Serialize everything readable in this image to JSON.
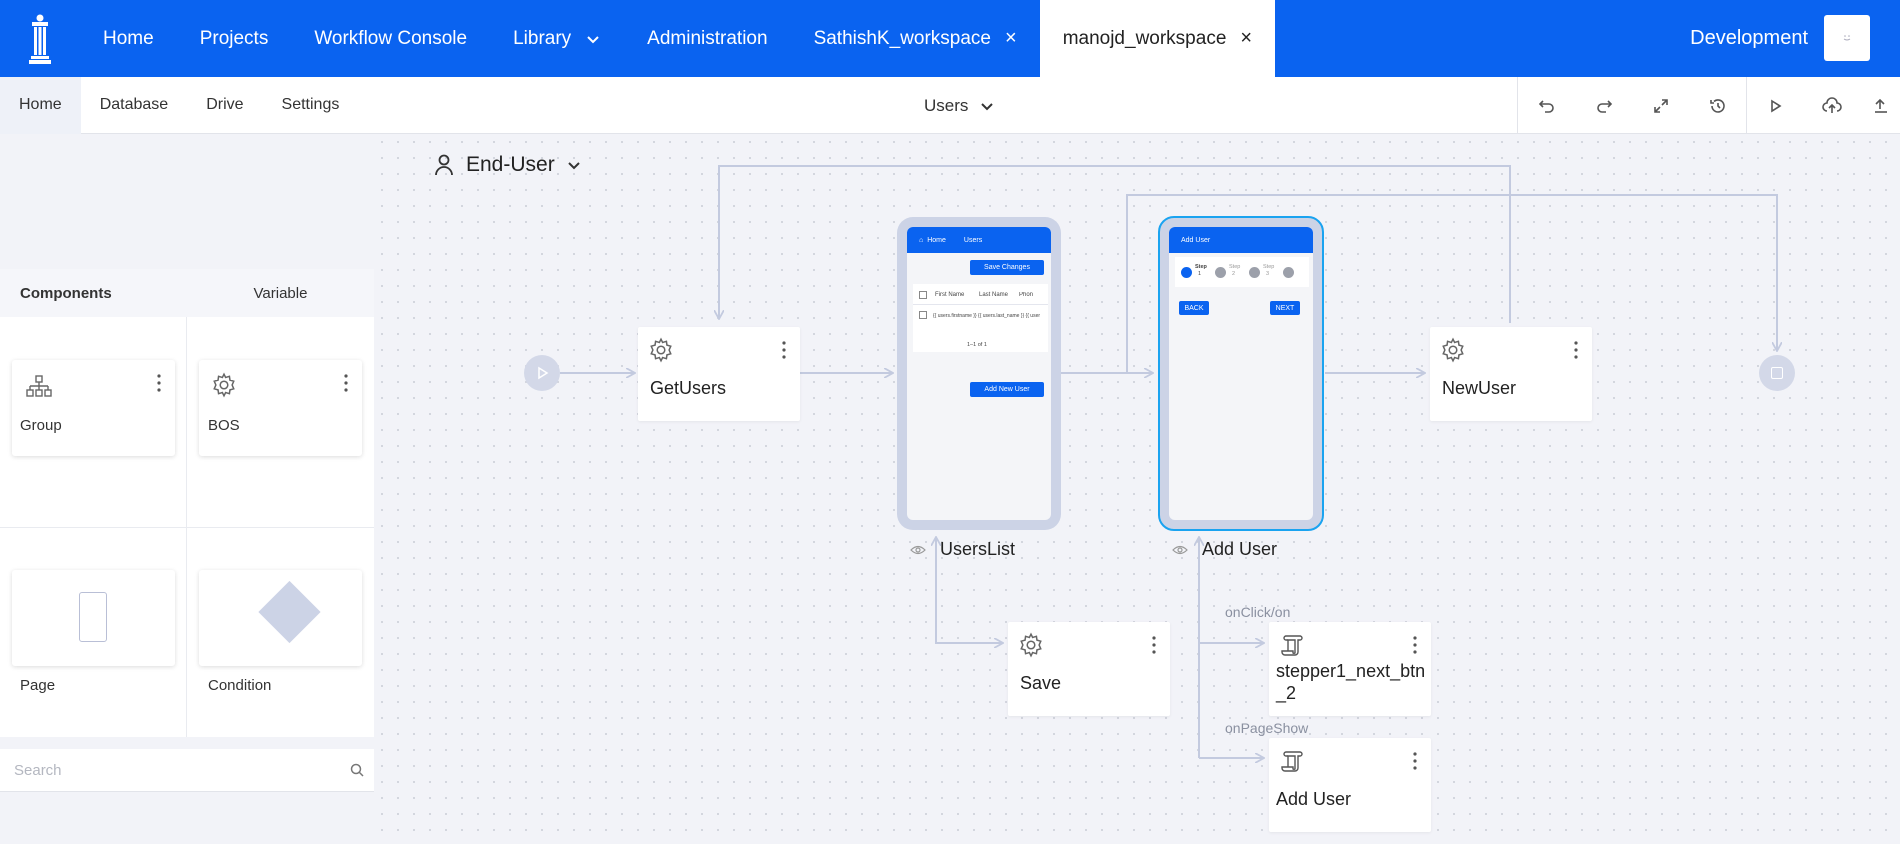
{
  "topnav": {
    "items": [
      "Home",
      "Projects",
      "Workflow Console",
      "Library",
      "Administration"
    ],
    "tabs": [
      {
        "label": "SathishK_workspace"
      },
      {
        "label": "manojd_workspace"
      }
    ],
    "close_glyph": "×",
    "environment": "Development",
    "colors": {
      "primary": "#0a63f0"
    }
  },
  "subnav": {
    "items": [
      "Home",
      "Database",
      "Drive",
      "Settings"
    ],
    "page_selector": "Users",
    "tools": [
      "undo-icon",
      "redo-icon",
      "expand-icon",
      "history-icon",
      "play-icon",
      "upload-cloud-icon",
      "publish-icon"
    ]
  },
  "left_panel": {
    "tabs": [
      "Components",
      "Variable"
    ],
    "components": [
      {
        "label": "Group",
        "icon": "group-tree-icon"
      },
      {
        "label": "BOS",
        "icon": "gear-icon"
      },
      {
        "label": "Page",
        "icon": "page-icon"
      },
      {
        "label": "Condition",
        "icon": "diamond-icon"
      }
    ],
    "search": {
      "placeholder": "Search",
      "value": ""
    }
  },
  "canvas": {
    "role_selector": "End-User",
    "nodes": {
      "get_users": "GetUsers",
      "new_user": "NewUser",
      "save": "Save",
      "stepper_line1": "stepper1_next_btn",
      "stepper_line2": "_2",
      "add_user_script": "Add User"
    },
    "pages": {
      "users_list": {
        "label": "UsersList",
        "header_home": "Home",
        "header_title": "Users",
        "save_button": "Save Changes",
        "col_first": "First Name",
        "col_last": "Last Name",
        "col_phone": "Phon",
        "row_text": "{{ users.firstname }} {{ users.last_name }} {{ user",
        "pagination": "1–1 of 1",
        "add_button": "Add New User"
      },
      "add_user": {
        "label": "Add User",
        "header_title": "Add User",
        "step_word": "Step",
        "steps": [
          "1",
          "2",
          "3"
        ],
        "back_button": "BACK",
        "next_button": "NEXT"
      }
    },
    "edge_labels": {
      "on_click": "onClick/on",
      "on_page_show": "onPageShow"
    }
  }
}
